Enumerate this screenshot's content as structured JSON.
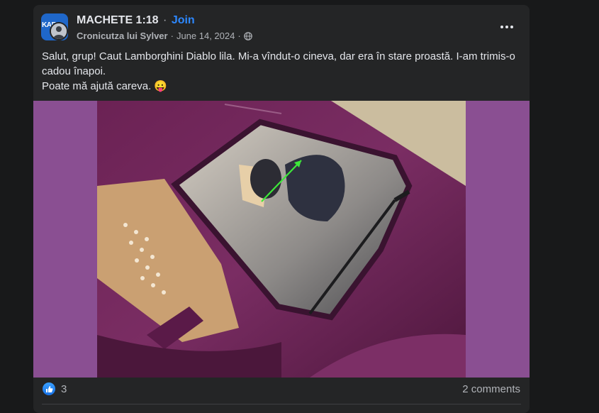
{
  "post": {
    "group_avatar_text": "KAF",
    "group_name": "MACHETE 1:18",
    "separator": "·",
    "join_label": "Join",
    "author": "Cronicutza lui Sylver",
    "date": "June 14, 2024",
    "privacy_icon": "globe-icon",
    "more_icon": "more-options-icon",
    "text_line1": "Salut, grup! Caut Lamborghini Diablo lila. Mi-a vîndut-o cineva, dar era în stare proastă. I-am trimis-o cadou înapoi.",
    "text_line2": "Poate mă ajută careva. 😛",
    "photo_background_color": "#8a4f92",
    "reactions": {
      "icon": "like-icon",
      "count": "3"
    },
    "comments_label": "2 comments"
  },
  "colors": {
    "page_background": "#18191a",
    "card_background": "#242526",
    "link_blue": "#2d88ff",
    "secondary_text": "#b0b3b8",
    "primary_text": "#e4e6eb",
    "arrow_green": "#3ee83a",
    "car_purple": "#6b2254"
  }
}
